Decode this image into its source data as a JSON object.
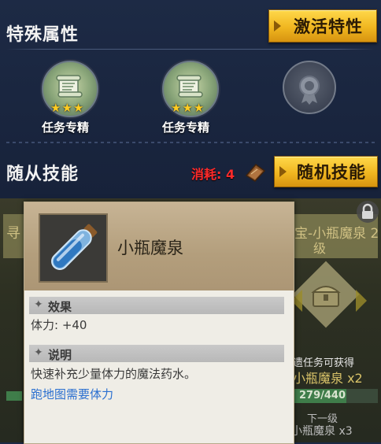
{
  "special_attributes": {
    "title": "特殊属性",
    "activate_button": "激活特性",
    "traits": [
      {
        "label": "任务专精",
        "stars": "★★★"
      },
      {
        "label": "任务专精",
        "stars": "★★★"
      },
      {
        "label": ""
      }
    ]
  },
  "follower_skills": {
    "title": "随从技能",
    "cost_label": "消耗: 4",
    "random_button": "随机技能"
  },
  "background": {
    "left_text": "寻",
    "right_title": "宝-小瓶魔泉 2",
    "right_title_2": "级",
    "reward_hint": "遗任务可获得",
    "reward_item": "小瓶魔泉 x2",
    "progress_text": "279/440",
    "progress": 0.63,
    "next_level_label": "下一级",
    "next_level_item": "小瓶魔泉 x3"
  },
  "tooltip": {
    "item_name": "小瓶魔泉",
    "effect_header": "效果",
    "effect_text": "体力: +40",
    "desc_header": "说明",
    "desc_text": "快速补充少量体力的魔法药水。",
    "link_text": "跑地图需要体力"
  },
  "colors": {
    "gold_button": "#f0b620",
    "cost_red": "#ff2a2a",
    "link_blue": "#2a6fd0"
  }
}
